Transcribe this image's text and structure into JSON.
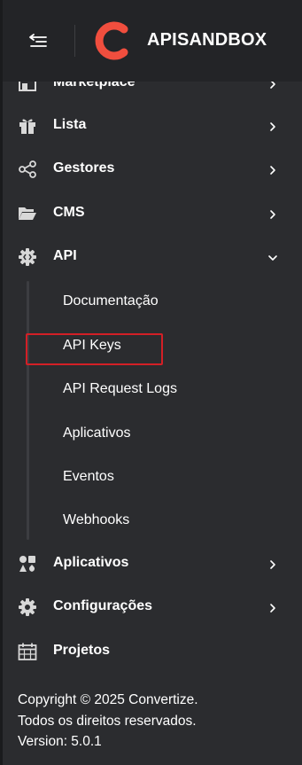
{
  "header": {
    "brand_name": "APISANDBOX",
    "logo_icon": "convertize-c-logo",
    "accent_color": "#f04e3e"
  },
  "menu": {
    "marketplace": {
      "label": "Marketplace",
      "icon": "store-icon"
    },
    "lista": {
      "label": "Lista",
      "icon": "gift-icon"
    },
    "gestores": {
      "label": "Gestores",
      "icon": "share-nodes-icon"
    },
    "cms": {
      "label": "CMS",
      "icon": "folder-open-icon"
    },
    "api": {
      "label": "API",
      "icon": "gear-code-icon",
      "expanded": true,
      "submenu": [
        {
          "label": "Documentação"
        },
        {
          "label": "API Keys"
        },
        {
          "label": "API Request Logs"
        },
        {
          "label": "Aplicativos"
        },
        {
          "label": "Eventos"
        },
        {
          "label": "Webhooks"
        }
      ]
    },
    "aplicativos": {
      "label": "Aplicativos",
      "icon": "apps-shapes-icon"
    },
    "configuracoes": {
      "label": "Configurações",
      "icon": "gear-icon"
    },
    "projetos": {
      "label": "Projetos",
      "icon": "calendar-icon"
    }
  },
  "footer": {
    "copyright": "Copyright © 2025 Convertize.",
    "rights": "Todos os direitos reservados.",
    "version": "Version: 5.0.1"
  },
  "highlight_color": "#d31f26"
}
